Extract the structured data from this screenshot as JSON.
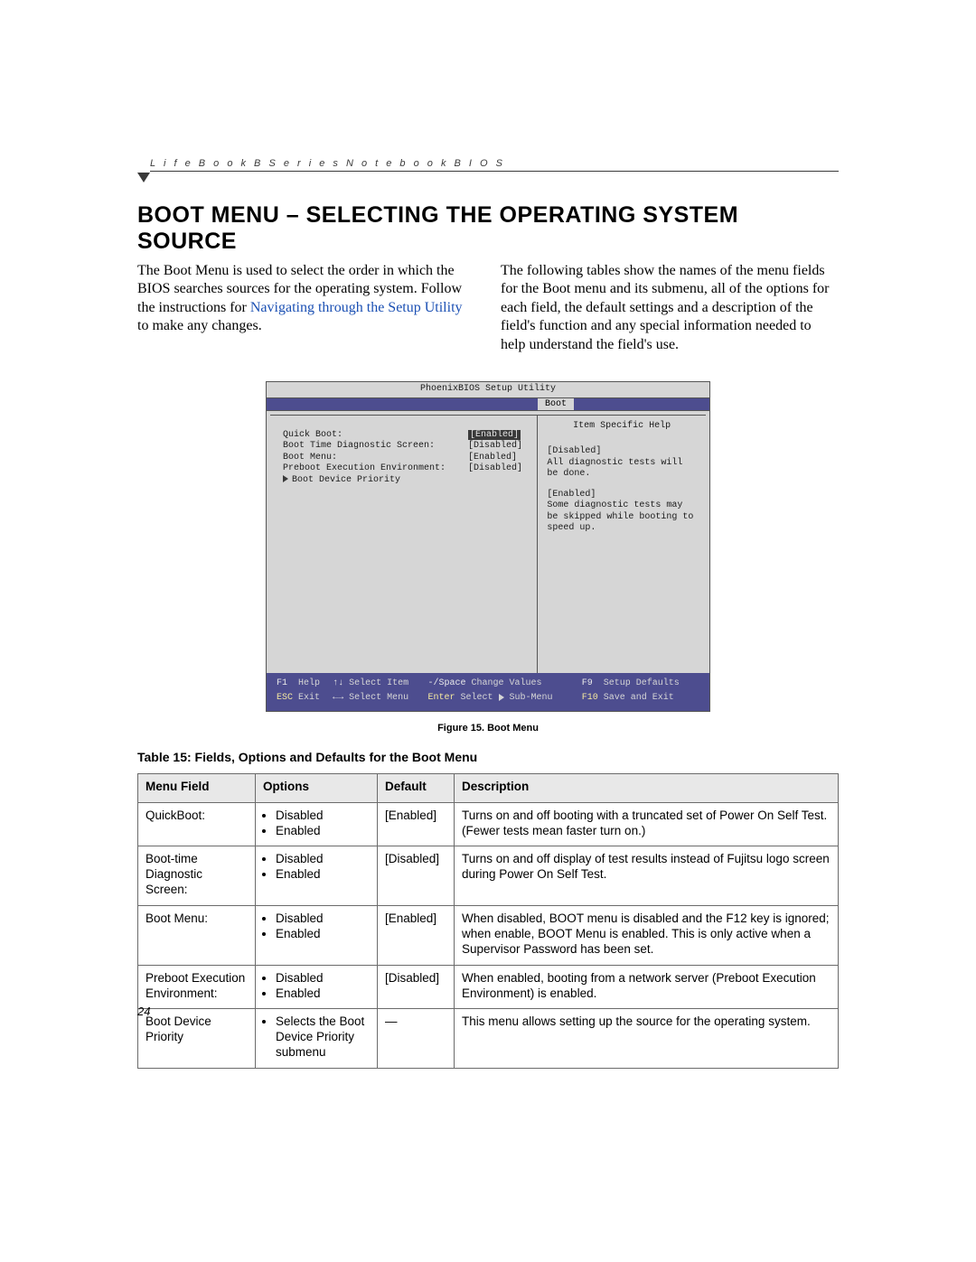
{
  "header": {
    "running_head": "L i f e B o o k   B   S e r i e s   N o t e b o o k   B I O S"
  },
  "title": "BOOT MENU – SELECTING THE OPERATING SYSTEM SOURCE",
  "intro": {
    "col1_a": "The Boot Menu is used to select the order in which the BIOS searches sources for the operating system. Follow the instructions for ",
    "col1_link": "Navigating through the Setup Utility",
    "col1_b": " to make any changes.",
    "col2": "The following tables show the names of the menu fields for the Boot menu and its submenu, all of the options for each field, the default settings and a description of the field's function and any special information needed to help understand the field's use."
  },
  "bios": {
    "utility_title": "PhoenixBIOS Setup Utility",
    "active_tab": "Boot",
    "items": [
      {
        "label": "Quick Boot:",
        "value": "[Enabled]",
        "selected": true
      },
      {
        "label": "Boot Time Diagnostic Screen:",
        "value": "[Disabled]"
      },
      {
        "label": "Boot Menu:",
        "value": "[Enabled]"
      },
      {
        "label": "Preboot Execution Environment:",
        "value": "[Disabled]"
      },
      {
        "label": "Boot Device Priority",
        "submenu": true
      }
    ],
    "help": {
      "title": "Item Specific Help",
      "p1": "[Disabled]",
      "p2": "All diagnostic tests will be done.",
      "p3": "[Enabled]",
      "p4": "Some diagnostic tests may be skipped while booting to speed up."
    },
    "footer": {
      "f1": "F1",
      "help": "Help",
      "updown": "↑↓",
      "select_item": "Select Item",
      "minus_space": "-/Space",
      "change_values": "Change Values",
      "f9": "F9",
      "setup_defaults": "Setup Defaults",
      "esc": "ESC",
      "exit": "Exit",
      "leftright": "←→",
      "select_menu": "Select Menu",
      "enter": "Enter",
      "select_sub": "Select",
      "submenu_word": "Sub-Menu",
      "f10": "F10",
      "save_exit": "Save and Exit"
    }
  },
  "figure_caption": "Figure 15.  Boot Menu",
  "table_title": "Table 15: Fields, Options and Defaults for the Boot Menu",
  "table": {
    "headers": [
      "Menu Field",
      "Options",
      "Default",
      "Description"
    ],
    "rows": [
      {
        "field": "QuickBoot:",
        "options": [
          "Disabled",
          "Enabled"
        ],
        "default": "[Enabled]",
        "description": "Turns on and off booting with a truncated set of Power On Self Test. (Fewer tests mean faster turn on.)"
      },
      {
        "field": "Boot-time Diagnostic Screen:",
        "options": [
          "Disabled",
          "Enabled"
        ],
        "default": "[Disabled]",
        "description": "Turns on and off display of test results instead of Fujitsu logo screen during Power On Self Test."
      },
      {
        "field": "Boot Menu:",
        "options": [
          "Disabled",
          "Enabled"
        ],
        "default": "[Enabled]",
        "description": "When disabled, BOOT menu is disabled and the F12 key is ignored; when enable, BOOT Menu is enabled. This is only active when a Supervisor Password has been set."
      },
      {
        "field": "Preboot Execution Environment:",
        "options": [
          "Disabled",
          "Enabled"
        ],
        "default": "[Disabled]",
        "description": "When enabled, booting from a network server (Preboot Execution Environment) is enabled."
      },
      {
        "field": "Boot Device Priority",
        "options": [
          "Selects the Boot Device Priority submenu"
        ],
        "default": "—",
        "description": "This menu allows setting up the source for the operating system."
      }
    ]
  },
  "page_number": "24"
}
